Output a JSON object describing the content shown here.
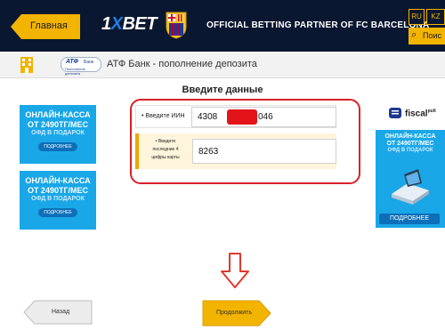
{
  "topbar": {
    "home_label": "Главная",
    "brand_one": "1",
    "brand_x": "X",
    "brand_bet": "BET",
    "partner_text": "OFFICIAL BETTING PARTNER OF FC BARCELONA",
    "lang_ru": "RU",
    "lang_kz": "KZ",
    "search_label": "Поис",
    "search_icon": "magnifier-icon"
  },
  "header": {
    "bank_logo_main": "АТФ",
    "bank_logo_word": "Банк",
    "bank_logo_sub": "Пополнение депозита",
    "title": "АТФ Банк - пополнение депозита"
  },
  "form": {
    "title": "Введите данные",
    "iin_label": "• Введите ИИН",
    "iin_value_start": "4308",
    "iin_value_end": "046",
    "card_label_line1": "• Введите",
    "card_label_line2": "последние 4",
    "card_label_line3": "цифры карты",
    "card_value": "8263"
  },
  "promo_left": [
    {
      "line1": "ОНЛАЙН-КАССА",
      "line2": "ОТ 2490ТГ/МЕС",
      "line3": "ОФД В ПОДАРОК",
      "more": "ПОДРОБНЕЕ"
    },
    {
      "line1": "ОНЛАЙН-КАССА",
      "line2": "ОТ 2490ТГ/МЕС",
      "line3": "ОФД В ПОДАРОК",
      "more": "ПОДРОБНЕЕ"
    }
  ],
  "promo_right": {
    "brand": "fiscal",
    "brand_suffix": "pult",
    "line1": "ОНЛАЙН-КАССА",
    "line2": "ОТ 2490ТГ/МЕС",
    "line3": "ОФД В ПОДАРОК",
    "more": "ПОДРОБНЕЕ"
  },
  "buttons": {
    "back_label": "Назад",
    "next_label": "Продолжить"
  },
  "colors": {
    "topbar_bg": "#0a1730",
    "accent_yellow": "#f3b400",
    "highlight_red": "#d82127",
    "promo_blue": "#1aa7e8"
  }
}
